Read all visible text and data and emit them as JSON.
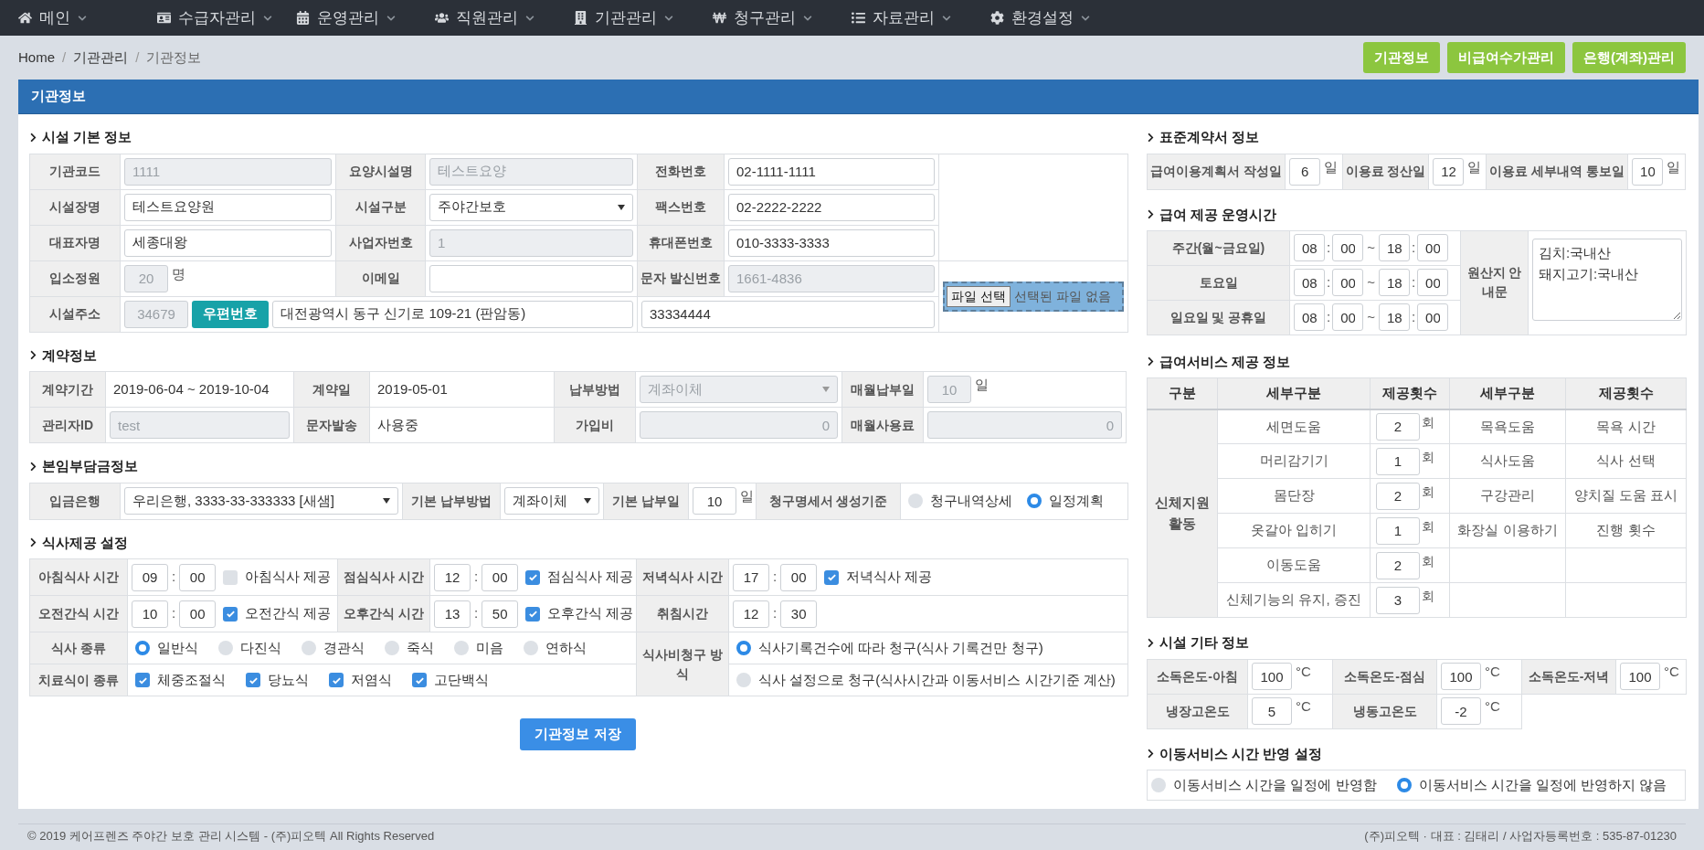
{
  "nav": [
    {
      "label": "메인"
    },
    {
      "label": "수급자관리"
    },
    {
      "label": "운영관리"
    },
    {
      "label": "직원관리"
    },
    {
      "label": "기관관리"
    },
    {
      "label": "청구관리"
    },
    {
      "label": "자료관리"
    },
    {
      "label": "환경설정"
    }
  ],
  "breadcrumb": [
    "Home",
    "기관관리",
    "기관정보"
  ],
  "breadcrumb_sep": "/",
  "top_buttons": [
    {
      "label": "기관정보"
    },
    {
      "label": "비급여수가관리"
    },
    {
      "label": "은행(계좌)관리"
    }
  ],
  "panel_title": "기관정보",
  "basic_info": {
    "title": "시설 기본 정보",
    "rows": [
      [
        {
          "kind": "label",
          "text": "기관코드"
        },
        {
          "kind": "input",
          "value": "1111",
          "disabled": true
        },
        {
          "kind": "label",
          "text": "요양시설명"
        },
        {
          "kind": "input",
          "value": "테스트요양",
          "disabled": true
        },
        {
          "kind": "label",
          "text": "전화번호"
        },
        {
          "kind": "input",
          "value": "02-1111-1111",
          "disabled": false
        }
      ],
      [
        {
          "kind": "label",
          "text": "시설장명"
        },
        {
          "kind": "input",
          "value": "테스트요양원",
          "disabled": false
        },
        {
          "kind": "label",
          "text": "시설구분"
        },
        {
          "kind": "select",
          "value": "주야간보호",
          "disabled": false
        },
        {
          "kind": "label",
          "text": "팩스번호"
        },
        {
          "kind": "input",
          "value": "02-2222-2222",
          "disabled": false
        }
      ],
      [
        {
          "kind": "label",
          "text": "대표자명"
        },
        {
          "kind": "input",
          "value": "세종대왕",
          "disabled": false
        },
        {
          "kind": "label",
          "text": "사업자번호"
        },
        {
          "kind": "input",
          "value": "1",
          "disabled": true
        },
        {
          "kind": "label",
          "text": "휴대폰번호"
        },
        {
          "kind": "input",
          "value": "010-3333-3333",
          "disabled": false
        }
      ],
      [
        {
          "kind": "label",
          "text": "입소정원"
        },
        {
          "kind": "number",
          "value": "20",
          "unit": "명",
          "disabled": true
        },
        {
          "kind": "label",
          "text": "이메일"
        },
        {
          "kind": "input",
          "disabled": false
        },
        {
          "kind": "label",
          "text": "문자 발신번호"
        },
        {
          "kind": "input",
          "value": "1661-4836",
          "disabled": true
        }
      ],
      [
        {
          "kind": "label",
          "text": "시설주소"
        },
        {
          "kind": "address",
          "colspan": 3,
          "zip": "34679",
          "button": "우편번호",
          "address": "대전광역시 동구 신기로 109-21 (판암동)"
        },
        {
          "kind": "input",
          "colspan": 2,
          "value": "33334444",
          "disabled": false
        }
      ]
    ],
    "file": {
      "button": "파일 선택",
      "status": "선택된 파일 없음"
    }
  },
  "contract": {
    "title": "계약정보",
    "rows": [
      [
        {
          "kind": "label",
          "text": "계약기간"
        },
        {
          "kind": "text",
          "text": "2019-06-04 ~ 2019-10-04"
        },
        {
          "kind": "label",
          "text": "계약일"
        },
        {
          "kind": "text",
          "text": "2019-05-01"
        },
        {
          "kind": "label",
          "text": "납부방법"
        },
        {
          "kind": "select",
          "value": "계좌이체",
          "disabled": true
        },
        {
          "kind": "label",
          "text": "매월납부일"
        },
        {
          "kind": "number",
          "value": "10",
          "unit": "일",
          "disabled": true
        }
      ],
      [
        {
          "kind": "label",
          "text": "관리자ID"
        },
        {
          "kind": "input",
          "value": "test",
          "disabled": true
        },
        {
          "kind": "label",
          "text": "문자발송"
        },
        {
          "kind": "text",
          "text": "사용중"
        },
        {
          "kind": "label",
          "text": "가입비"
        },
        {
          "kind": "amount",
          "value": "0",
          "disabled": true
        },
        {
          "kind": "label",
          "text": "매월사용료"
        },
        {
          "kind": "amount",
          "value": "0",
          "disabled": true
        }
      ]
    ]
  },
  "copay": {
    "title": "본임부담금정보",
    "cells": [
      {
        "kind": "label",
        "text": "입금은행"
      },
      {
        "kind": "select",
        "value": "우리은행, 3333-33-333333 [새샘]",
        "disabled": false
      },
      {
        "kind": "label",
        "text": "기본 납부방법"
      },
      {
        "kind": "select",
        "value": "계좌이체",
        "disabled": false
      },
      {
        "kind": "label",
        "text": "기본 납부일"
      },
      {
        "kind": "number",
        "value": "10",
        "unit": "일",
        "disabled": false
      },
      {
        "kind": "label",
        "text": "청구명세서 생성기준"
      },
      {
        "kind": "radios",
        "options": [
          {
            "label": "청구내역상세",
            "selected": false
          },
          {
            "label": "일정계획",
            "selected": true
          }
        ]
      }
    ]
  },
  "meal": {
    "title": "식사제공 설정",
    "rows": [
      [
        {
          "kind": "label",
          "text": "아침식사 시간"
        },
        {
          "kind": "time",
          "hour": "09",
          "sep": ":",
          "minute": "00",
          "check": {
            "label": "아침식사 제공",
            "checked": false
          }
        },
        {
          "kind": "label",
          "text": "점심식사 시간"
        },
        {
          "kind": "time",
          "hour": "12",
          "sep": ":",
          "minute": "00",
          "check": {
            "label": "점심식사 제공",
            "checked": true
          }
        },
        {
          "kind": "label",
          "text": "저녁식사 시간"
        },
        {
          "kind": "time",
          "hour": "17",
          "sep": ":",
          "minute": "00",
          "check": {
            "label": "저녁식사 제공",
            "checked": true
          }
        }
      ],
      [
        {
          "kind": "label",
          "text": "오전간식 시간"
        },
        {
          "kind": "time",
          "hour": "10",
          "sep": ":",
          "minute": "00",
          "check": {
            "label": "오전간식 제공",
            "checked": true
          }
        },
        {
          "kind": "label",
          "text": "오후간식 시간"
        },
        {
          "kind": "time",
          "hour": "13",
          "sep": ":",
          "minute": "50",
          "check": {
            "label": "오후간식 제공",
            "checked": true
          }
        },
        {
          "kind": "label",
          "text": "취침시간"
        },
        {
          "kind": "time",
          "hour": "12",
          "sep": ":",
          "minute": "30"
        }
      ]
    ],
    "types": {
      "label": "식사 종류",
      "options": [
        {
          "label": "일반식",
          "selected": true
        },
        {
          "label": "다진식",
          "selected": false
        },
        {
          "label": "경관식",
          "selected": false
        },
        {
          "label": "죽식",
          "selected": false
        },
        {
          "label": "미음",
          "selected": false
        },
        {
          "label": "연하식",
          "selected": false
        }
      ]
    },
    "therapy": {
      "label": "치료식이 종류",
      "options": [
        {
          "label": "체중조절식",
          "checked": true
        },
        {
          "label": "당뇨식",
          "checked": true
        },
        {
          "label": "저염식",
          "checked": true
        },
        {
          "label": "고단백식",
          "checked": true
        }
      ]
    },
    "billing": {
      "label": "식사비청구 방식",
      "options": [
        {
          "label": "식사기록건수에 따라 청구(식사 기록건만 청구)",
          "selected": true
        },
        {
          "label": "식사 설정으로 청구(식사시간과 이동서비스 시간기준 계산)",
          "selected": false
        }
      ]
    }
  },
  "save_button": "기관정보 저장",
  "standard_contract": {
    "title": "표준계약서 정보",
    "cells": [
      {
        "kind": "label",
        "text": "급여이용계획서 작성일"
      },
      {
        "kind": "number",
        "value": "6",
        "unit": "일",
        "disabled": false
      },
      {
        "kind": "label",
        "text": "이용료 정산일"
      },
      {
        "kind": "number",
        "value": "12",
        "unit": "일",
        "disabled": false
      },
      {
        "kind": "label",
        "text": "이용료 세부내역 통보일"
      },
      {
        "kind": "number",
        "value": "10",
        "unit": "일",
        "disabled": false
      }
    ]
  },
  "hours": {
    "title": "급여 제공 운영시간",
    "rows": [
      {
        "label": "주간(월~금요일)",
        "from": {
          "hour": "08",
          "sep": ":",
          "minute": "00"
        },
        "range_sep": "~",
        "to": {
          "hour": "18",
          "sep": ":",
          "minute": "00"
        }
      },
      {
        "label": "토요일",
        "from": {
          "hour": "08",
          "sep": ":",
          "minute": "00"
        },
        "range_sep": "~",
        "to": {
          "hour": "18",
          "sep": ":",
          "minute": "00"
        }
      },
      {
        "label": "일요일 및 공휴일",
        "from": {
          "hour": "08",
          "sep": ":",
          "minute": "00"
        },
        "range_sep": "~",
        "to": {
          "hour": "18",
          "sep": ":",
          "minute": "00"
        }
      }
    ],
    "notice_label": "원산지 안내문",
    "notice": "김치:국내산\n돼지고기:국내산"
  },
  "services": {
    "title": "급여서비스 제공 정보",
    "columns": [
      "구분",
      "세부구분",
      "제공횟수",
      "세부구분",
      "제공횟수"
    ],
    "group": "신체지원 활동",
    "rows": [
      {
        "detail": "세면도움",
        "count": "2",
        "unit": "회",
        "detail_2": "목욕도움",
        "column_5": "목욕 시간"
      },
      {
        "detail": "머리감기기",
        "count": "1",
        "unit": "회",
        "detail_2": "식사도움",
        "column_5": "식사 선택"
      },
      {
        "detail": "몸단장",
        "count": "2",
        "unit": "회",
        "detail_2": "구강관리",
        "column_5": "양치질 도움 표시"
      },
      {
        "detail": "옷갈아 입히기",
        "count": "1",
        "unit": "회",
        "detail_2": "화장실 이용하기",
        "column_5": "진행 횟수"
      },
      {
        "detail": "이동도움",
        "count": "2",
        "unit": "회"
      },
      {
        "detail": "신체기능의 유지, 증진",
        "count": "3",
        "unit": "회"
      }
    ]
  },
  "facility_etc": {
    "title": "시설 기타 정보",
    "rows": [
      [
        {
          "kind": "label",
          "text": "소독온도-아침"
        },
        {
          "kind": "number",
          "value": "100",
          "unit": "°C",
          "disabled": false
        },
        {
          "kind": "label",
          "text": "소독온도-점심"
        },
        {
          "kind": "number",
          "value": "100",
          "unit": "°C",
          "disabled": false
        },
        {
          "kind": "label",
          "text": "소독온도-저녁"
        },
        {
          "kind": "number",
          "value": "100",
          "unit": "°C",
          "disabled": false
        }
      ],
      [
        {
          "kind": "label",
          "text": "냉장고온도"
        },
        {
          "kind": "number",
          "value": "5",
          "unit": "°C",
          "disabled": false
        },
        {
          "kind": "label",
          "text": "냉동고온도"
        },
        {
          "kind": "number",
          "value": "-2",
          "unit": "°C",
          "disabled": false
        }
      ]
    ]
  },
  "transport": {
    "title": "이동서비스 시간 반영 설정",
    "options": [
      {
        "label": "이동서비스 시간을 일정에 반영함",
        "selected": false
      },
      {
        "label": "이동서비스 시간을 일정에 반영하지 않음",
        "selected": true
      }
    ]
  },
  "footer": {
    "left": "© 2019 케어프렌즈 주야간 보호 관리 시스템 - (주)피오텍 All Rights Reserved",
    "right": "(주)피오텍 · 대표 : 김태리 / 사업자등록번호 : 535-87-01230"
  }
}
